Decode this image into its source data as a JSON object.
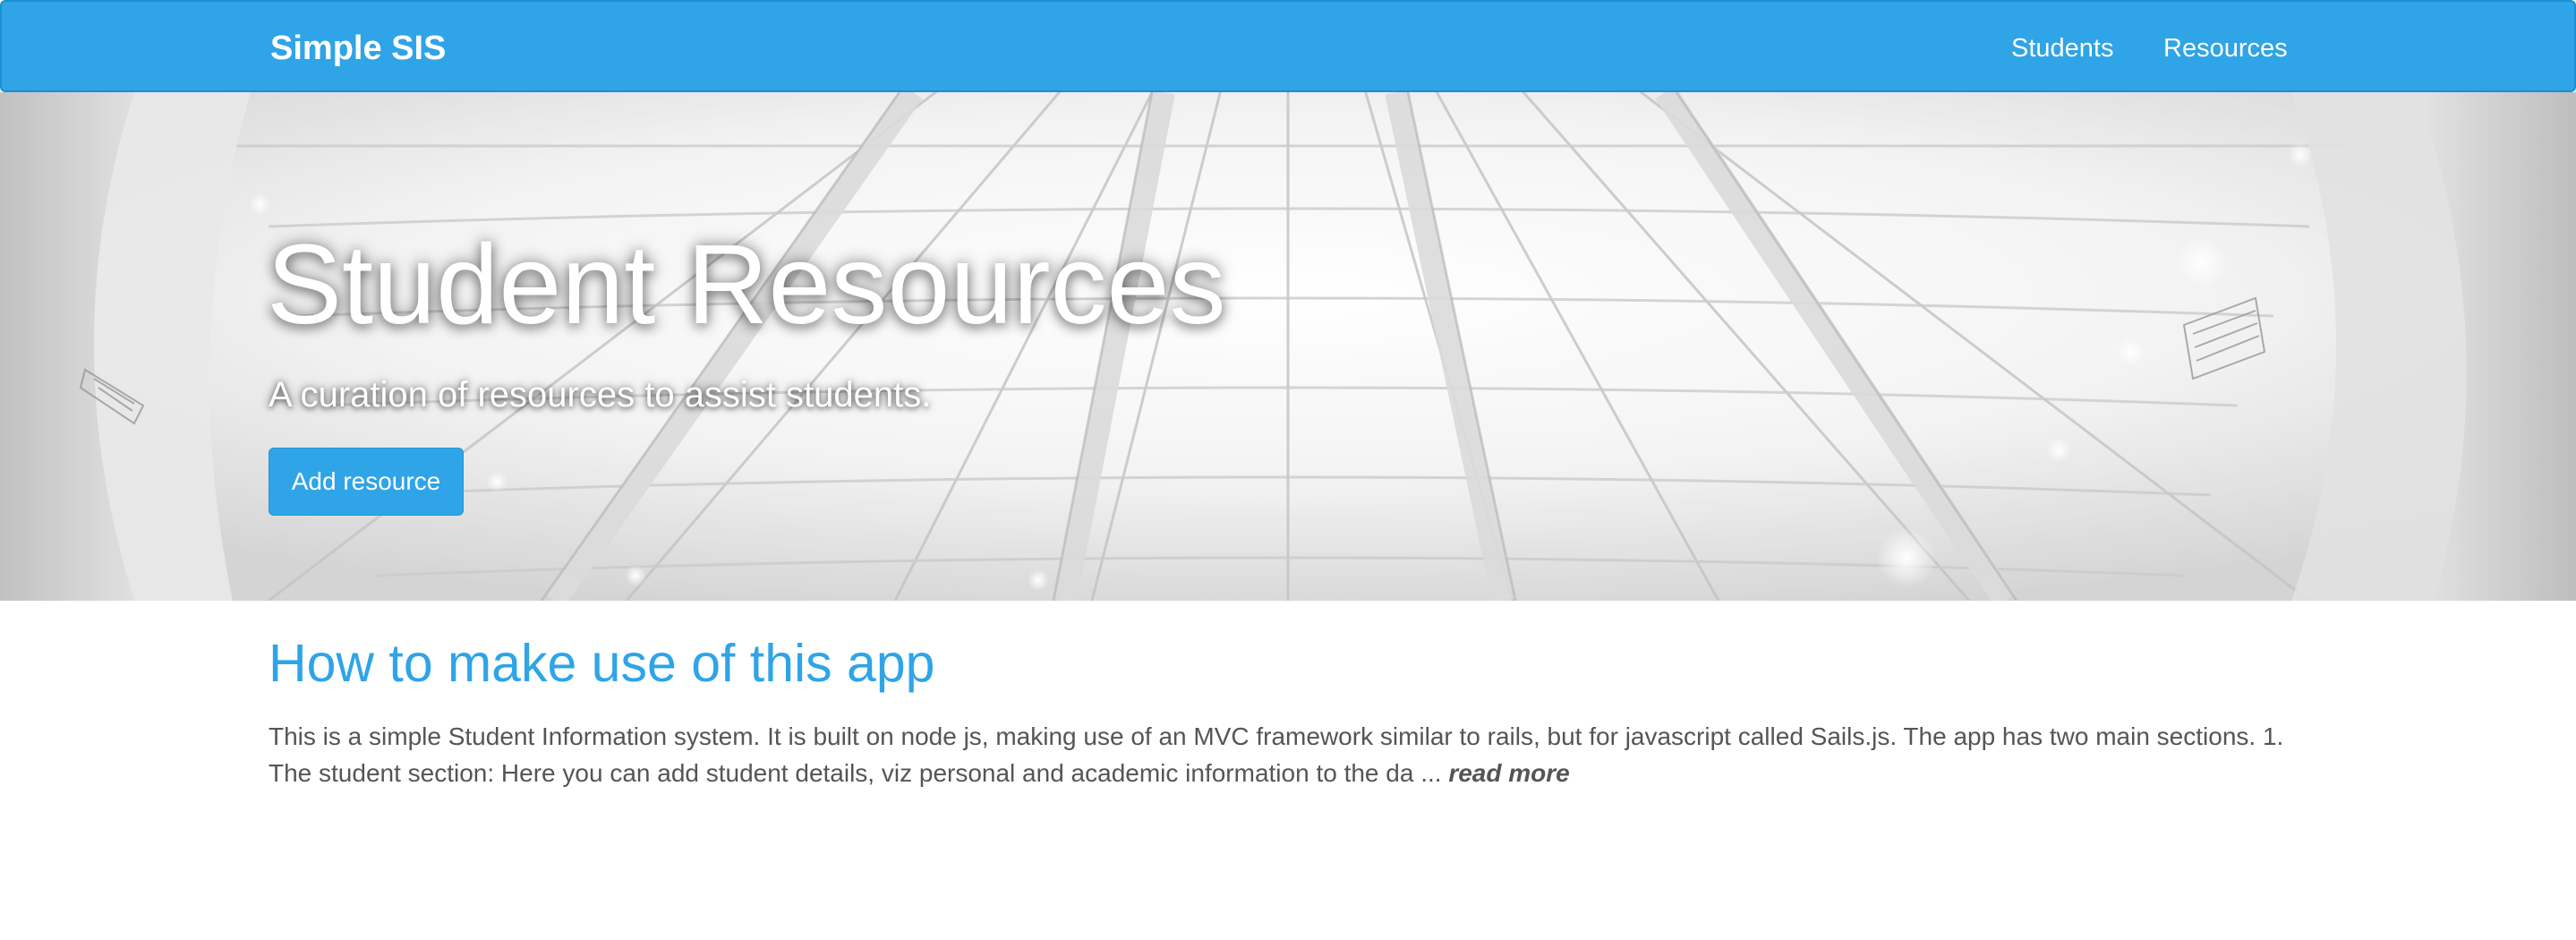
{
  "navbar": {
    "brand": "Simple SIS",
    "links": [
      "Students",
      "Resources"
    ]
  },
  "hero": {
    "title": "Student Resources",
    "subtitle": "A curation of resources to assist students.",
    "add_button_label": "Add resource"
  },
  "article": {
    "title": "How to make use of this app",
    "excerpt": "This is a simple Student Information system. It is built on node js, making use of an MVC framework similar to rails, but for javascript called Sails.js. The app has two main sections. 1. The student section: Here you can add student details, viz personal and academic information to the da ...",
    "read_more": "read more"
  },
  "colors": {
    "primary": "#2fa4e7",
    "text": "#555555",
    "hero_text": "#ffffff"
  }
}
